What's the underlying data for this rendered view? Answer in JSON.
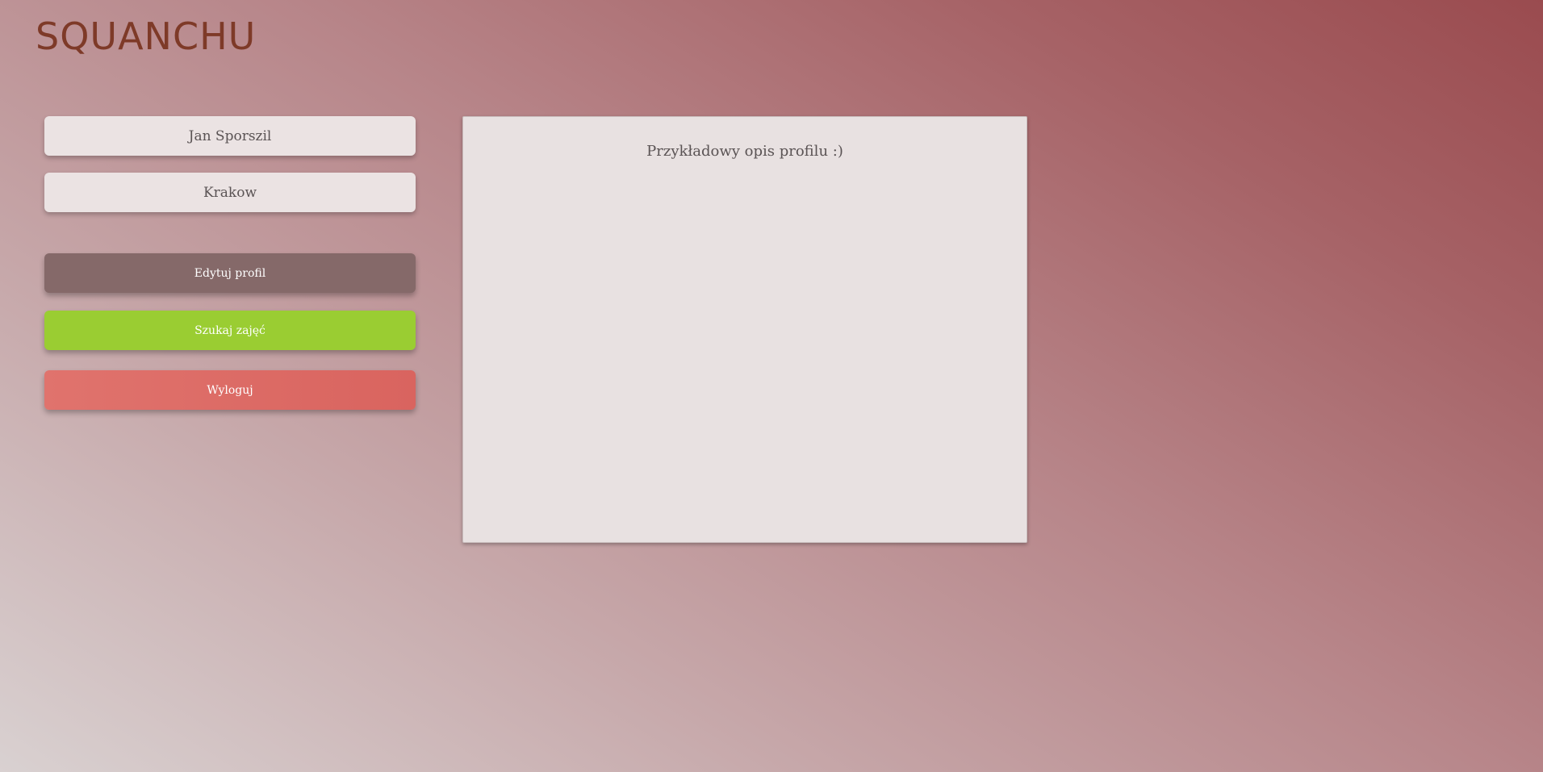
{
  "app": {
    "logo": "SQUANCHU"
  },
  "profile": {
    "name": "Jan Sporszil",
    "city": "Krakow",
    "description": "Przykładowy opis profilu :)"
  },
  "actions": {
    "edit_label": "Edytuj profil",
    "search_label": "Szukaj zajęć",
    "logout_label": "Wyloguj"
  },
  "colors": {
    "logo": "#7e3a28",
    "edit_button": "#856969",
    "search_button": "#9acd32",
    "logout_button": "#dc6b66",
    "card_background": "#ebe3e3"
  }
}
